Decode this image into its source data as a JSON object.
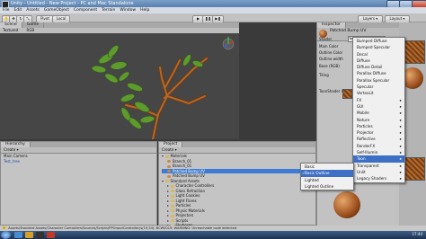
{
  "window": {
    "title": "Unity - Untitled - New Project - PC and Mac Standalone"
  },
  "menubar": [
    "File",
    "Edit",
    "Assets",
    "GameObject",
    "Component",
    "Terrain",
    "Window",
    "Help"
  ],
  "toolbar": {
    "layers": "Layers",
    "layout": "Layout"
  },
  "scene": {
    "tabs": [
      "Scene",
      "Game"
    ],
    "sub": {
      "shading": "Textured",
      "mode": "RGB"
    }
  },
  "hierarchy": {
    "tab": "Hierarchy",
    "create": "Create",
    "items": [
      "Main Camera",
      "Test_tree"
    ]
  },
  "project": {
    "tab": "Project",
    "create": "Create",
    "items": [
      {
        "label": "Materials",
        "depth": 0,
        "folder": true,
        "open": true
      },
      {
        "label": "Branch_01",
        "depth": 1,
        "folder": false
      },
      {
        "label": "Branch_01",
        "depth": 1,
        "folder": false
      },
      {
        "label": "Patched Bump UV",
        "depth": 1,
        "folder": false,
        "selected": true
      },
      {
        "label": "Patched Bump UV",
        "depth": 1,
        "folder": false
      },
      {
        "label": "Standard Assets",
        "depth": 0,
        "folder": true,
        "open": true
      },
      {
        "label": "Character Controllers",
        "depth": 1,
        "folder": true
      },
      {
        "label": "Glass Refraction",
        "depth": 1,
        "folder": true
      },
      {
        "label": "Light Cookies",
        "depth": 1,
        "folder": true
      },
      {
        "label": "Light Flares",
        "depth": 1,
        "folder": true
      },
      {
        "label": "Particles",
        "depth": 1,
        "folder": true
      },
      {
        "label": "Physic Materials",
        "depth": 1,
        "folder": true
      },
      {
        "label": "Projectors",
        "depth": 1,
        "folder": true
      },
      {
        "label": "Scripts",
        "depth": 1,
        "folder": true
      },
      {
        "label": "Skyboxes",
        "depth": 1,
        "folder": true
      }
    ]
  },
  "inspector": {
    "tab": "Inspector",
    "material": "Patched Bump UV",
    "shader_label": "Shader",
    "shader_value": "Toon/Basic Outline",
    "props": [
      "Main Color",
      "Outline Color",
      "Outline width",
      "Base (RGB)",
      "Tiling",
      "ToonShader Cu..."
    ]
  },
  "shader_menu": [
    {
      "label": "Bumped Diffuse"
    },
    {
      "label": "Bumped Specular"
    },
    {
      "label": "Decal"
    },
    {
      "label": "Diffuse"
    },
    {
      "label": "Diffuse Detail"
    },
    {
      "label": "Parallax Diffuse"
    },
    {
      "label": "Parallax Specular"
    },
    {
      "label": "Specular"
    },
    {
      "label": "VertexLit"
    },
    {
      "label": "FX",
      "sub": true
    },
    {
      "label": "GUI",
      "sub": true
    },
    {
      "label": "Mobile",
      "sub": true
    },
    {
      "label": "Nature",
      "sub": true
    },
    {
      "label": "Particles",
      "sub": true
    },
    {
      "label": "Projector",
      "sub": true
    },
    {
      "label": "Reflective",
      "sub": true
    },
    {
      "label": "RenderFX",
      "sub": true
    },
    {
      "label": "Self-Illumin",
      "sub": true
    },
    {
      "label": "Toon",
      "sub": true,
      "highlight": true
    },
    {
      "label": "Transparent",
      "sub": true
    },
    {
      "label": "Unlit",
      "sub": true
    },
    {
      "label": "Legacy Shaders",
      "sub": true
    }
  ],
  "toon_menu": [
    {
      "label": "Basic"
    },
    {
      "label": "Basic Outline",
      "checked": true,
      "highlight": true
    },
    {
      "label": "Lighted"
    },
    {
      "label": "Lighted Outline"
    }
  ],
  "statusbar": "Assets/Standard Assets/Character Controllers/Sources/Scripts/FPSInputController.js(19,54): BCW0015: WARNING: Unreachable code detected.",
  "taskbar": {
    "time": "17:44"
  },
  "colors": {
    "accent": "#3d7bd4",
    "scene_bg": "#454545"
  }
}
